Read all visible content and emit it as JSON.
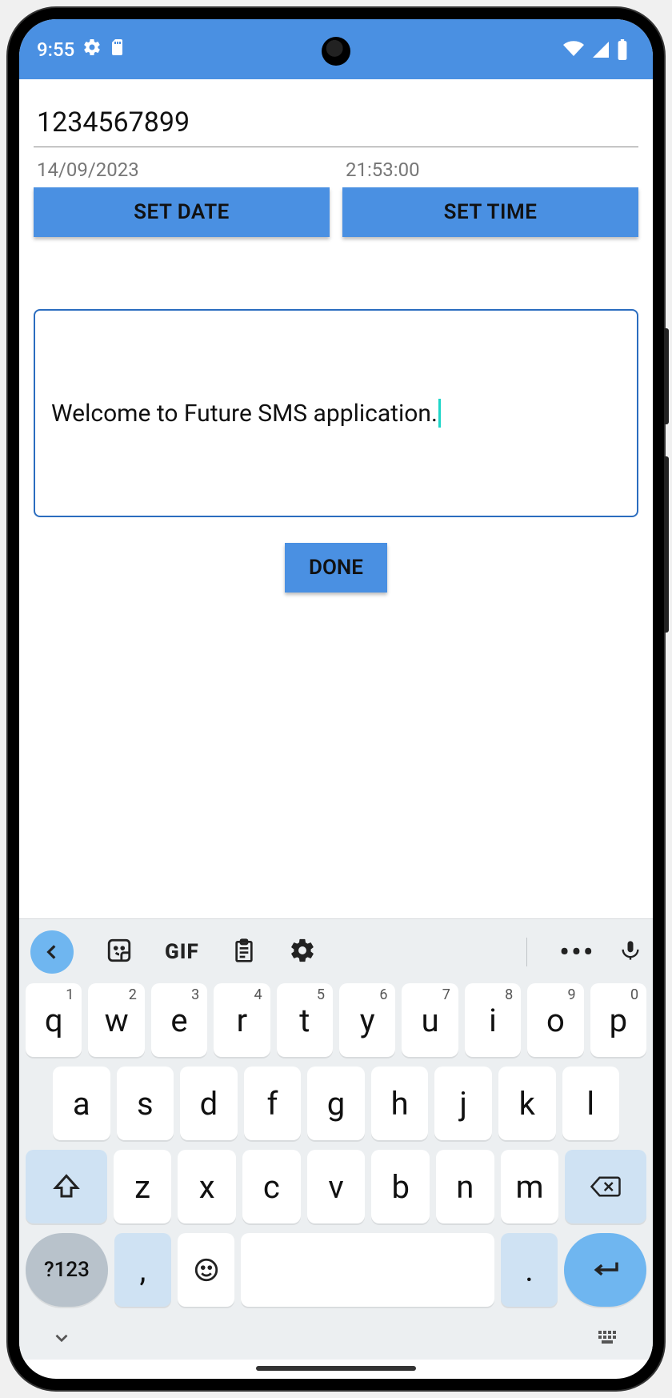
{
  "status": {
    "time": "9:55",
    "icons": [
      "gear-icon",
      "sd-card-icon"
    ],
    "right_icons": [
      "wifi-icon",
      "signal-icon",
      "battery-icon"
    ]
  },
  "form": {
    "phone_value": "1234567899",
    "date_label": "14/09/2023",
    "time_label": "21:53:00",
    "set_date_btn": "SET DATE",
    "set_time_btn": "SET TIME",
    "message_value": "Welcome to Future SMS application.",
    "done_btn": "DONE"
  },
  "keyboard": {
    "toolbar": {
      "back_icon": "chevron-left",
      "sticker_icon": "sticker",
      "gif_label": "GIF",
      "clipboard_icon": "clipboard",
      "settings_icon": "gear",
      "more_icon": "more",
      "mic_icon": "mic"
    },
    "row1": [
      {
        "k": "q",
        "s": "1"
      },
      {
        "k": "w",
        "s": "2"
      },
      {
        "k": "e",
        "s": "3"
      },
      {
        "k": "r",
        "s": "4"
      },
      {
        "k": "t",
        "s": "5"
      },
      {
        "k": "y",
        "s": "6"
      },
      {
        "k": "u",
        "s": "7"
      },
      {
        "k": "i",
        "s": "8"
      },
      {
        "k": "o",
        "s": "9"
      },
      {
        "k": "p",
        "s": "0"
      }
    ],
    "row2": [
      "a",
      "s",
      "d",
      "f",
      "g",
      "h",
      "j",
      "k",
      "l"
    ],
    "row3": [
      "z",
      "x",
      "c",
      "v",
      "b",
      "n",
      "m"
    ],
    "row5": {
      "numeric": "?123",
      "comma": ",",
      "period": "."
    }
  }
}
